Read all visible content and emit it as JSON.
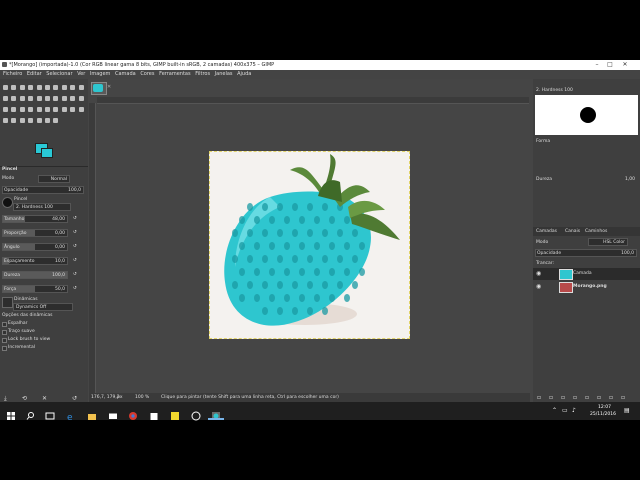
{
  "window": {
    "title": "*[Morango] (importada)-1.0 (Cor RGB linear gama 8 bits, GIMP built-in sRGB, 2 camadas) 400x375 – GIMP",
    "minimize": "–",
    "maximize": "□",
    "close": "✕"
  },
  "menubar": [
    "Ficheiro",
    "Editar",
    "Selecionar",
    "Ver",
    "Imagem",
    "Camada",
    "Cores",
    "Ferramentas",
    "Filtros",
    "Janelas",
    "Ajuda"
  ],
  "toolbox": {
    "fg_color": "#29c9d6",
    "bg_color": "#29c9d6",
    "tool_title": "Pincel",
    "mode_label": "Modo",
    "mode_value": "Normal",
    "opacity_label": "Opacidade",
    "opacity_value": "100,0",
    "brush_label": "Pincel",
    "brush_value": "2. Hardness 100",
    "sliders": [
      {
        "label": "Tamanho",
        "value": "48,00",
        "fraction": 0.35
      },
      {
        "label": "Proporção",
        "value": "0,00",
        "fraction": 0.5
      },
      {
        "label": "Ângulo",
        "value": "0,00",
        "fraction": 0.5
      },
      {
        "label": "Espaçamento",
        "value": "10,0",
        "fraction": 0.1
      },
      {
        "label": "Dureza",
        "value": "100,0",
        "fraction": 1.0
      },
      {
        "label": "Força",
        "value": "50,0",
        "fraction": 0.5
      }
    ],
    "dynamics_label": "Dinâmicas",
    "dynamics_value": "Dynamics Off",
    "options": [
      "Opções das dinâmicas",
      "Espalhar",
      "Traço suave",
      "Lock brush to view",
      "Incremental"
    ]
  },
  "status": {
    "coords": "176,7, 179,3",
    "unit": "px",
    "zoom": "100 %",
    "message": "Clique para pintar (tente Shift para uma linha reta, Ctrl para escolher uma cor)"
  },
  "rightdock": {
    "brush_header": "2. Hardness 100",
    "forma_label": "Forma",
    "dureza_label": "Dureza",
    "dureza_value": "1,00",
    "tabs": [
      "Camadas",
      "Canais",
      "Caminhos"
    ],
    "mode_label": "Modo",
    "mode_value": "HSL Color",
    "opacity_label": "Opacidade",
    "opacity_value": "100,0",
    "lock_label": "Trancar:",
    "layers": [
      {
        "name": "Camada",
        "selected": true
      },
      {
        "name": "Morango.png",
        "selected": false
      }
    ]
  },
  "taskbar": {
    "time": "12:07",
    "date": "25/11/2016"
  },
  "colors": {
    "strawberry": "#2ec6cf",
    "leaves": "#5b8a3b"
  }
}
